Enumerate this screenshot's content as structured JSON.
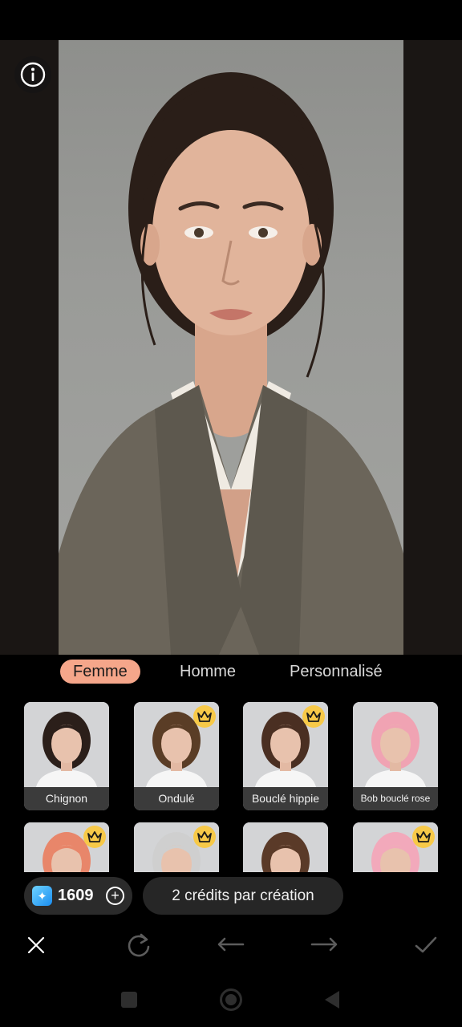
{
  "editor": {
    "info_icon": "info-icon"
  },
  "tabs": [
    {
      "label": "Femme",
      "active": true
    },
    {
      "label": "Homme",
      "active": false
    },
    {
      "label": "Personnalisé",
      "active": false
    }
  ],
  "styles": [
    {
      "label": "Chignon",
      "premium": false,
      "hair": "#2b1f1a"
    },
    {
      "label": "Ondulé",
      "premium": true,
      "hair": "#5a3d26"
    },
    {
      "label": "Bouclé hippie",
      "premium": true,
      "hair": "#4a2f22"
    },
    {
      "label": "Bob bouclé rose",
      "premium": false,
      "hair": "#f0a3b3"
    },
    {
      "label": "",
      "premium": true,
      "hair": "#e8866a"
    },
    {
      "label": "",
      "premium": true,
      "hair": "#cfcfcf"
    },
    {
      "label": "",
      "premium": false,
      "hair": "#5a3a28"
    },
    {
      "label": "",
      "premium": true,
      "hair": "#f2a9bb"
    }
  ],
  "credits": {
    "count": "1609",
    "gem_icon": "gem-icon",
    "add_icon": "plus-circle-icon"
  },
  "tooltip": {
    "text": "2 crédits par création"
  },
  "toolbar": {
    "icons": [
      "close-icon",
      "redo-refresh-icon",
      "undo-icon",
      "redo-icon",
      "check-icon"
    ]
  },
  "colors": {
    "accent_tab": "#f5a68a",
    "crown": "#f7c948"
  }
}
